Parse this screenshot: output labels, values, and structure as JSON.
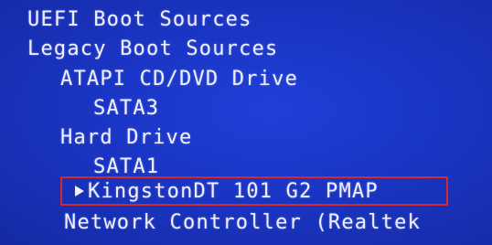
{
  "boot_menu": {
    "items": [
      {
        "label": "UEFI Boot Sources"
      },
      {
        "label": "Legacy Boot Sources"
      },
      {
        "label": "ATAPI CD/DVD Drive"
      },
      {
        "label": "SATA3"
      },
      {
        "label": "Hard Drive"
      },
      {
        "label": "SATA1"
      },
      {
        "label": "KingstonDT 101 G2 PMAP",
        "selected": true
      },
      {
        "label": "Network Controller (Realtek"
      }
    ],
    "selected_marker_icon": "triangle-right-icon",
    "colors": {
      "background": "#1a35c4",
      "text": "#eef0ff",
      "highlight_border": "#d62a2a"
    }
  }
}
